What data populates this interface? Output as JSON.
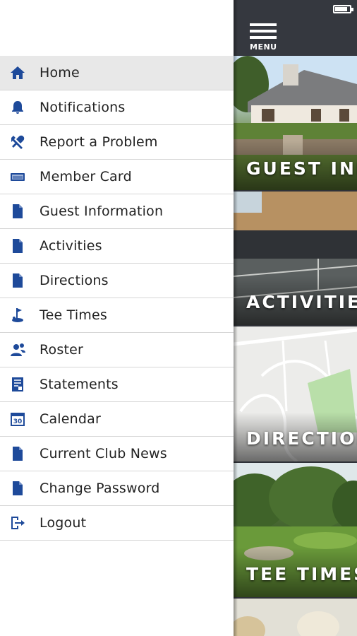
{
  "status_bar": {
    "battery_level": 0.75
  },
  "header": {
    "menu_label": "MENU"
  },
  "drawer": {
    "items": [
      {
        "label": "Home",
        "icon": "home-icon",
        "active": true
      },
      {
        "label": "Notifications",
        "icon": "bell-icon"
      },
      {
        "label": "Report a Problem",
        "icon": "tools-icon"
      },
      {
        "label": "Member Card",
        "icon": "card-icon"
      },
      {
        "label": "Guest Information",
        "icon": "document-icon"
      },
      {
        "label": "Activities",
        "icon": "document-icon"
      },
      {
        "label": "Directions",
        "icon": "document-icon"
      },
      {
        "label": "Tee Times",
        "icon": "golf-icon"
      },
      {
        "label": "Roster",
        "icon": "people-icon"
      },
      {
        "label": "Statements",
        "icon": "statement-icon"
      },
      {
        "label": "Calendar",
        "icon": "calendar-icon"
      },
      {
        "label": "Current Club News",
        "icon": "document-icon"
      },
      {
        "label": "Change Password",
        "icon": "document-icon"
      },
      {
        "label": "Logout",
        "icon": "logout-icon"
      }
    ]
  },
  "tiles": [
    {
      "caption": "GUEST INFORMATION"
    },
    {
      "caption": "ACTIVITIES"
    },
    {
      "caption": "DIRECTIONS"
    },
    {
      "caption": "TEE TIMES"
    }
  ],
  "colors": {
    "icon": "#1e4a9a",
    "active_row": "#e8e8e8",
    "pane_bg": "#2f3238"
  },
  "calendar_icon_day": "30"
}
